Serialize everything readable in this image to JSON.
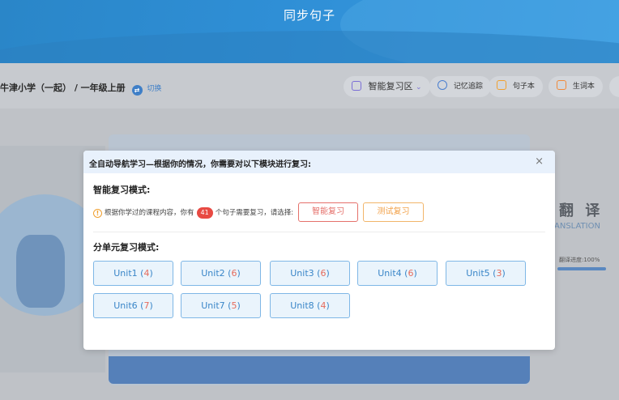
{
  "header": {
    "title": "同步句子"
  },
  "toolbar": {
    "breadcrumb": "牛津小学（一起） / 一年级上册",
    "switch_label": "切换",
    "items": [
      {
        "label": "智能复习区",
        "color": "#7b6fd6"
      },
      {
        "label": "记忆追踪",
        "color": "#4a7fd0"
      },
      {
        "label": "句子本",
        "color": "#f0a030"
      },
      {
        "label": "生词本",
        "color": "#f08a3a"
      }
    ]
  },
  "background": {
    "word": "翻 译",
    "word_en": "ANSLATION",
    "progress_label": "翻译进度:100%"
  },
  "modal": {
    "title": "全自动导航学习—根据你的情况，你需要对以下模块进行复习:",
    "smart_section_title": "智能复习模式:",
    "notice_prefix": "根据你学过的课程内容，你有",
    "notice_count": "41",
    "notice_suffix": "个句子需要复习，请选择:",
    "smart_button": "智能复习",
    "test_button": "测试复习",
    "unit_section_title": "分单元复习模式:",
    "units": [
      {
        "name": "Unit1",
        "count": "4"
      },
      {
        "name": "Unit2",
        "count": "6"
      },
      {
        "name": "Unit3",
        "count": "6"
      },
      {
        "name": "Unit4",
        "count": "6"
      },
      {
        "name": "Unit5",
        "count": "3"
      },
      {
        "name": "Unit6",
        "count": "7"
      },
      {
        "name": "Unit7",
        "count": "5"
      },
      {
        "name": "Unit8",
        "count": "4"
      }
    ]
  }
}
